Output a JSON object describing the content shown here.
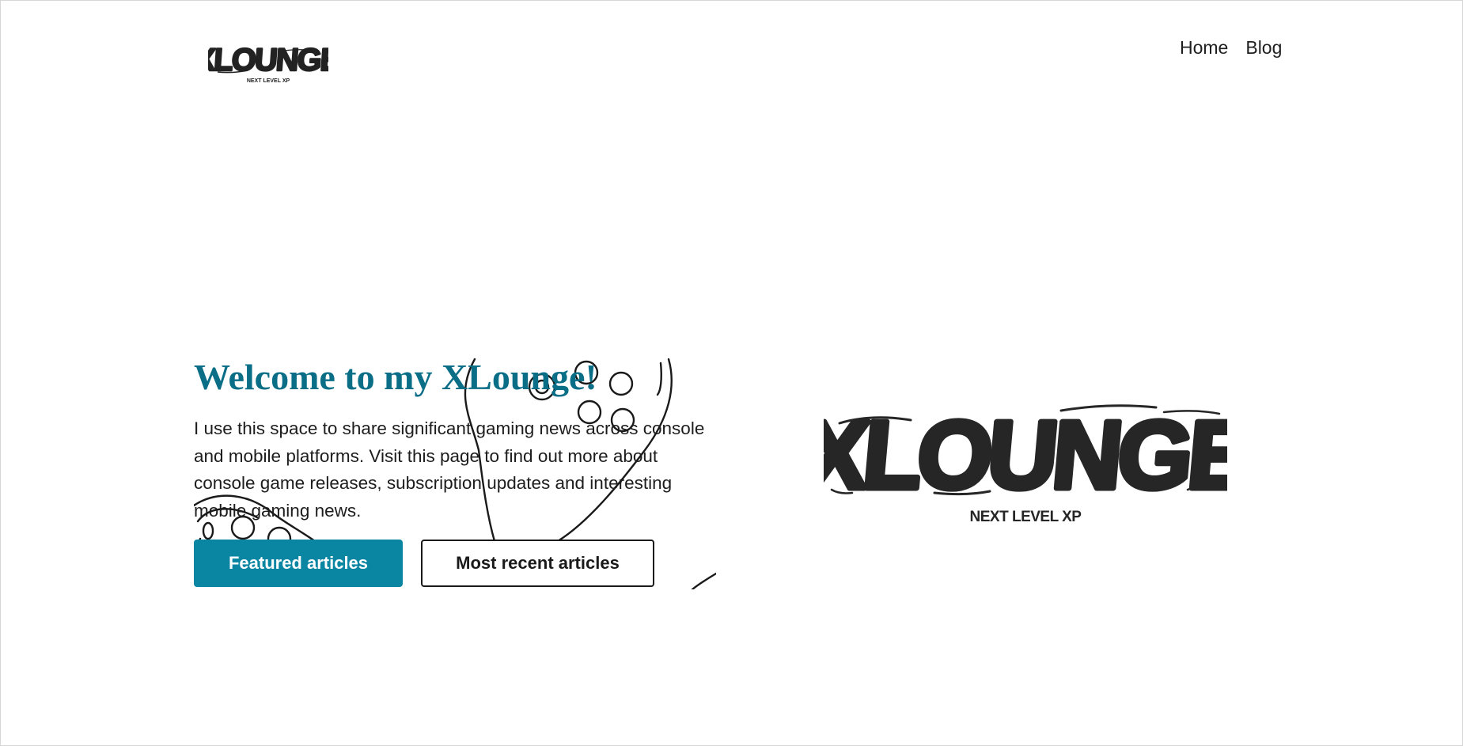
{
  "header": {
    "logo_text": "XLOUNGE",
    "logo_tagline": "NEXT LEVEL XP",
    "nav": [
      {
        "label": "Home"
      },
      {
        "label": "Blog"
      }
    ]
  },
  "hero": {
    "title": "Welcome to my XLounge!",
    "description": "I use this space to share significant gaming news across console and mobile platforms. Visit this page to find out more about console game releases, subscription updates and interesting mobile gaming news.",
    "primary_button": "Featured articles",
    "secondary_button": "Most recent articles",
    "logo_text": "XLOUNGE",
    "logo_tagline": "NEXT LEVEL XP"
  },
  "colors": {
    "accent": "#0a86a3",
    "title": "#0b6e87",
    "text": "#1d1d1d",
    "background": "#ffffff"
  },
  "icons": {
    "background_art": "gamepad-doodle-icon"
  }
}
